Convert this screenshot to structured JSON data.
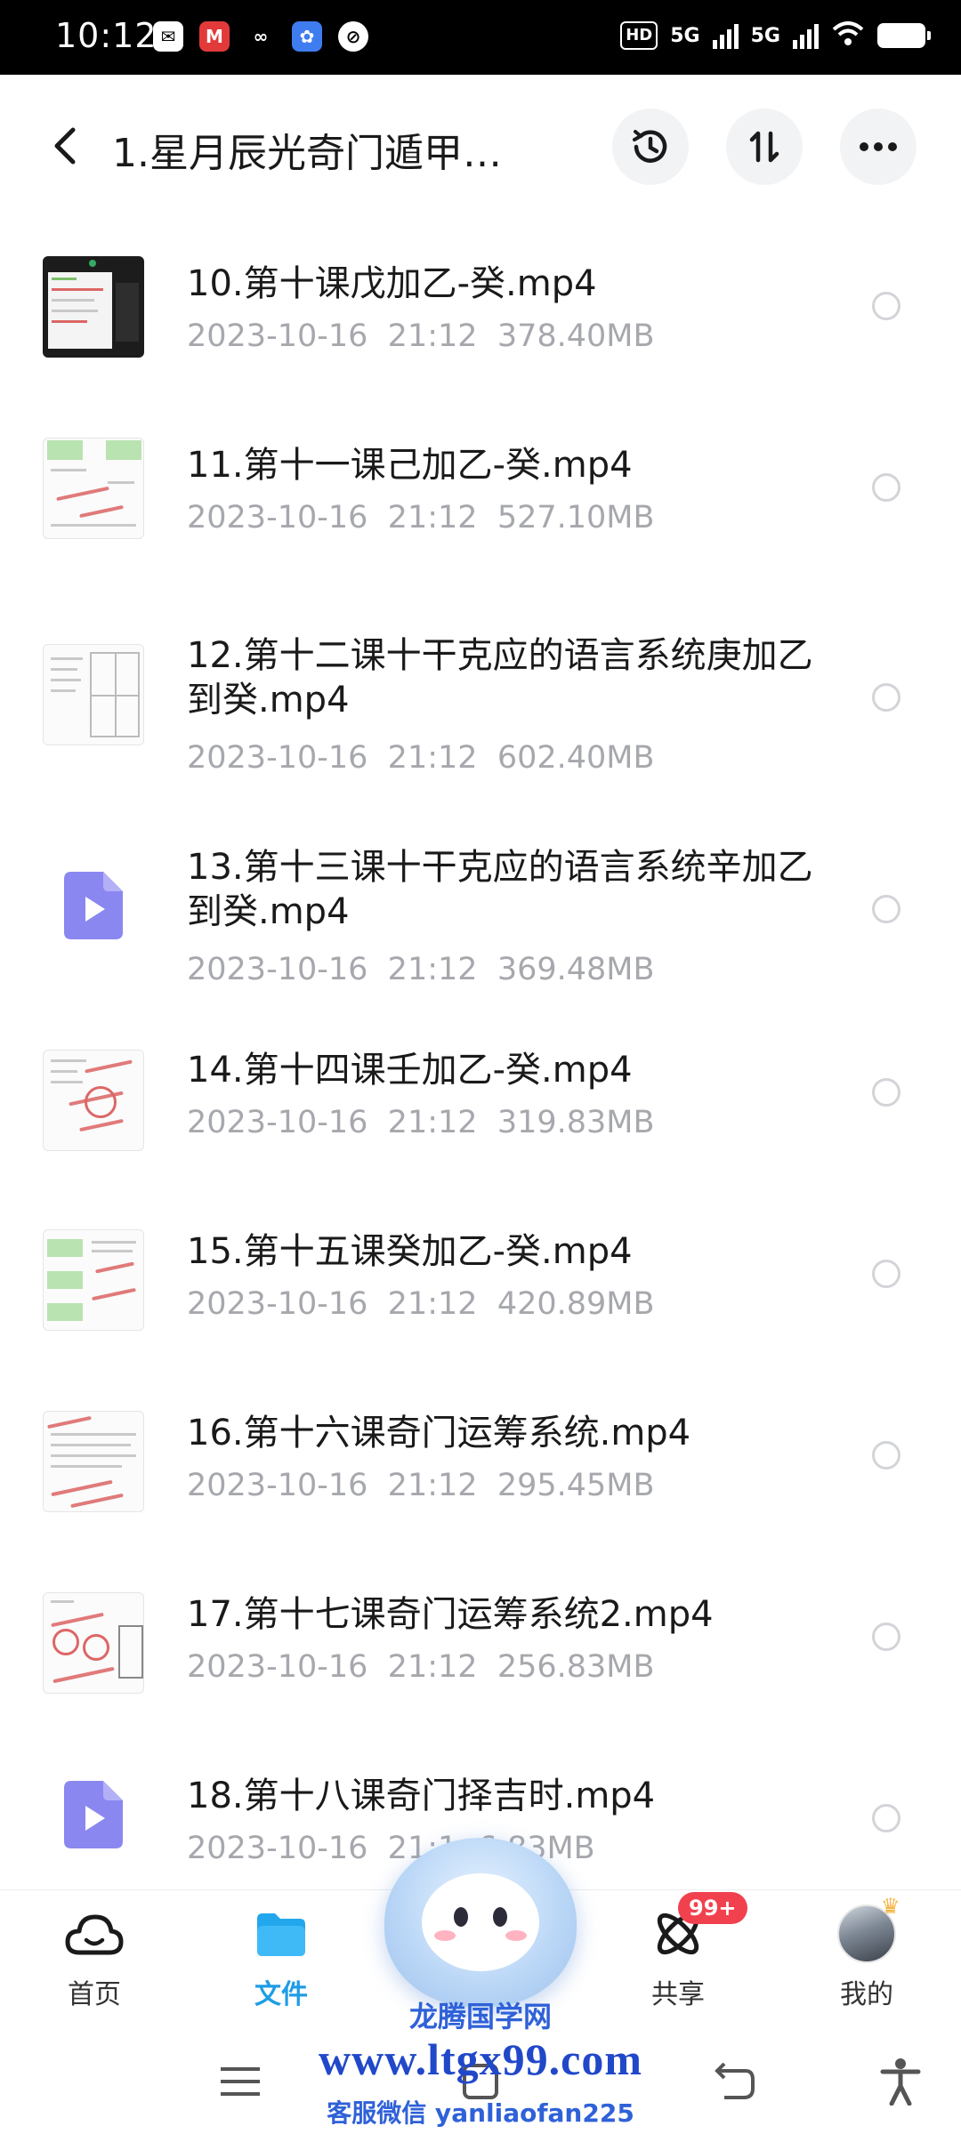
{
  "status_bar": {
    "time": "10:12",
    "app_icons": [
      "wechat-icon",
      "cmb-bank-icon",
      "baidu-netdisk-icon",
      "baidu-icon",
      "app-icon"
    ],
    "network": "HD",
    "sim1": "5G",
    "sim2": "5G"
  },
  "header": {
    "title": "1.星月辰光奇门遁甲…",
    "actions": [
      "history-icon",
      "sort-icon",
      "more-icon"
    ]
  },
  "files": [
    {
      "name": "10.第十课戊加乙-癸.mp4",
      "date": "2023-10-16",
      "time": "21:12",
      "size": "378.40MB",
      "thumb": "video-frame"
    },
    {
      "name": "11.第十一课己加乙-癸.mp4",
      "date": "2023-10-16",
      "time": "21:12",
      "size": "527.10MB",
      "thumb": "chart-grid"
    },
    {
      "name": "12.第十二课十干克应的语言系统庚加乙到癸.mp4",
      "date": "2023-10-16",
      "time": "21:12",
      "size": "602.40MB",
      "thumb": "text-doc"
    },
    {
      "name": "13.第十三课十干克应的语言系统辛加乙到癸.mp4",
      "date": "2023-10-16",
      "time": "21:12",
      "size": "369.48MB",
      "thumb": "video-file"
    },
    {
      "name": "14.第十四课壬加乙-癸.mp4",
      "date": "2023-10-16",
      "time": "21:12",
      "size": "319.83MB",
      "thumb": "annotated-doc"
    },
    {
      "name": "15.第十五课癸加乙-癸.mp4",
      "date": "2023-10-16",
      "time": "21:12",
      "size": "420.89MB",
      "thumb": "chart-grid"
    },
    {
      "name": "16.第十六课奇门运筹系统.mp4",
      "date": "2023-10-16",
      "time": "21:12",
      "size": "295.45MB",
      "thumb": "annotated-doc"
    },
    {
      "name": "17.第十七课奇门运筹系统2.mp4",
      "date": "2023-10-16",
      "time": "21:12",
      "size": "256.83MB",
      "thumb": "annotated-doc"
    },
    {
      "name": "18.第十八课奇门择吉时.mp4",
      "date": "2023-10-16",
      "time": "21:1",
      "size": "6.83MB",
      "thumb": "video-file"
    }
  ],
  "bottom_nav": [
    {
      "label": "首页",
      "icon": "cloud-icon",
      "active": false
    },
    {
      "label": "文件",
      "icon": "folder-icon",
      "active": true
    },
    {
      "label": "共享",
      "icon": "atom-icon",
      "active": false,
      "badge": "99+"
    },
    {
      "label": "我的",
      "icon": "avatar",
      "active": false
    }
  ],
  "watermark": {
    "name": "龙腾国学网",
    "url": "www.ltgx99.com",
    "contact": "客服微信 yanliaofan225"
  },
  "colors": {
    "accent": "#1e9de6",
    "play_icon": "#8b87f0",
    "badge": "#f2414e",
    "meta_text": "#a6a8ad",
    "watermark": "#2148c9"
  }
}
